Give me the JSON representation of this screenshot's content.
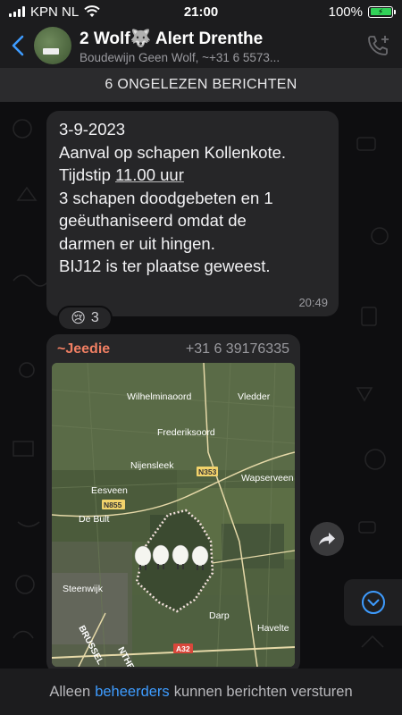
{
  "status_bar": {
    "carrier": "KPN NL",
    "time": "21:00",
    "battery": "100%",
    "battery_level": 1.0
  },
  "header": {
    "title": "2 Wolf🐺 Alert Drenthe",
    "members": "Boudewijn Geen Wolf, ~+31 6 5573..."
  },
  "unread_banner": "6 ONGELEZEN BERICHTEN",
  "messages": [
    {
      "lines": [
        "3-9-2023",
        "Aanval op schapen Kollenkote.",
        "Tijdstip 11.00 uur",
        "3 schapen doodgebeten en 1",
        "geëuthaniseerd omdat de",
        "darmen er uit hingen.",
        "BIJ12 is ter plaatse geweest."
      ],
      "line3_prefix": "Tijdstip ",
      "line3_underlined": "11.00 uur",
      "time": "20:49",
      "reaction": {
        "emoji": "😢",
        "count": "3"
      }
    },
    {
      "sender": "~Jeedie",
      "phone": "+31 6 39176335",
      "map_labels": {
        "wilhelminaoord": "Wilhelminaoord",
        "vledder": "Vledder",
        "frederiksoord": "Frederiksoord",
        "nijensleek": "Nijensleek",
        "n353": "N353",
        "wapserveen": "Wapserveen",
        "eesveen": "Eesveen",
        "n855": "N855",
        "de_bult": "De Bult",
        "steenwijk": "Steenwijk",
        "darp": "Darp",
        "havelte": "Havelte",
        "brussel": "BRUSSEL",
        "a32": "A32",
        "nthe": "NTHE"
      }
    }
  ],
  "footer": {
    "prefix": "Alleen",
    "link": "beheerders",
    "suffix": "kunnen berichten versturen"
  },
  "colors": {
    "accent": "#3e9cff",
    "sender": "#f07f63",
    "bubble": "#262628",
    "battery": "#31d158"
  }
}
